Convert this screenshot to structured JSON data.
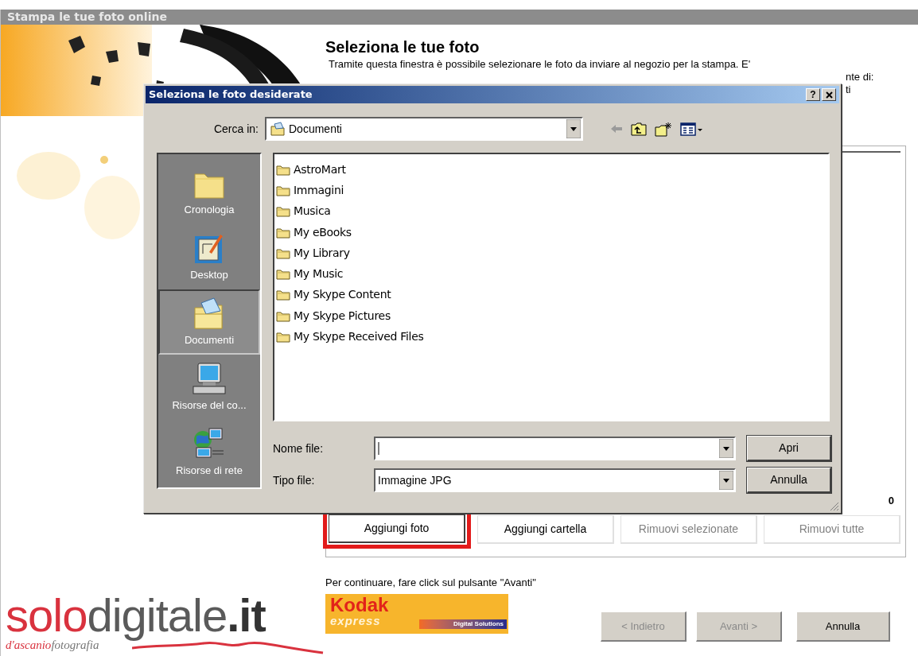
{
  "window": {
    "title": "Stampa le tue foto online"
  },
  "header": {
    "heading": "Seleziona le tue foto",
    "description": [
      "Tramite questa finestra è possibile selezionare le foto da inviare al negozio per la stampa. E'",
      "nte di:",
      "ti"
    ]
  },
  "photo_list": {
    "total_value": "0"
  },
  "actions": [
    {
      "label": "Aggiungi foto",
      "disabled": false,
      "highlighted": true
    },
    {
      "label": "Aggiungi cartella",
      "disabled": false,
      "highlighted": false
    },
    {
      "label": "Rimuovi selezionate",
      "disabled": true,
      "highlighted": false
    },
    {
      "label": "Rimuovi tutte",
      "disabled": true,
      "highlighted": false
    }
  ],
  "footer": {
    "hint": "Per continuare, fare click sul pulsante \"Avanti\"",
    "nav_buttons": [
      {
        "label": "< Indietro",
        "disabled": true
      },
      {
        "label": "Avanti >",
        "disabled": true
      },
      {
        "label": "Annulla",
        "disabled": false
      }
    ]
  },
  "logos": {
    "solodigitale": [
      "solo",
      "digitale",
      ".it"
    ],
    "tagline": [
      "d'ascanio",
      "fotografia"
    ],
    "kodak": {
      "brand": "Kodak",
      "sub": "express",
      "band": "Digital Solutions"
    }
  },
  "dialog": {
    "title": "Seleziona le foto desiderate",
    "help": "?",
    "look_in": {
      "label": "Cerca in:",
      "value": "Documenti"
    },
    "places": [
      {
        "label": "Cronologia",
        "selected": false
      },
      {
        "label": "Desktop",
        "selected": false
      },
      {
        "label": "Documenti",
        "selected": true
      },
      {
        "label": "Risorse del co...",
        "selected": false
      },
      {
        "label": "Risorse di rete",
        "selected": false
      }
    ],
    "files": [
      "AstroMart",
      "Immagini",
      "Musica",
      "My eBooks",
      "My Library",
      "My Music",
      "My Skype Content",
      "My Skype Pictures",
      "My Skype Received Files"
    ],
    "file_name": {
      "label": "Nome file:"
    },
    "file_type": {
      "label": "Tipo file:",
      "value": "Immagine JPG"
    },
    "buttons": [
      "Apri",
      "Annulla"
    ]
  }
}
